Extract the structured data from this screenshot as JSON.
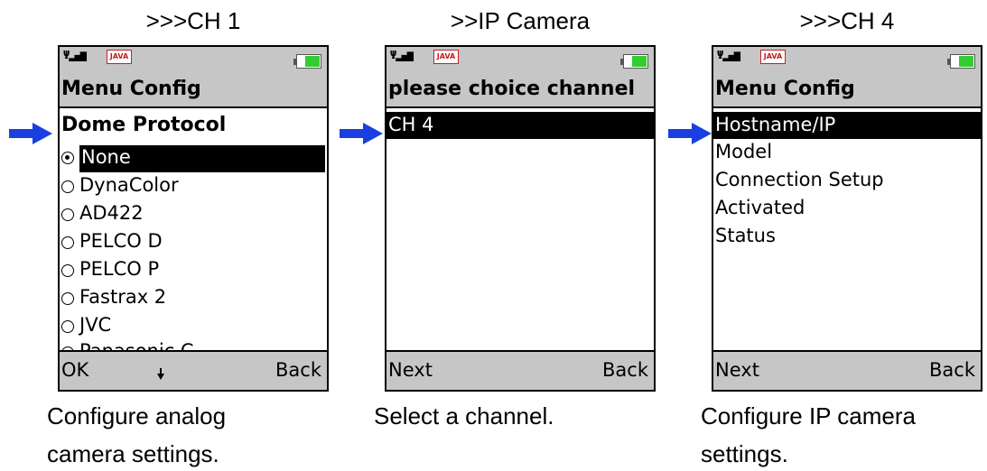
{
  "colors": {
    "arrow": "#1a3fe0",
    "chrome": "#c6c6c6",
    "highlight": "#000000",
    "battery": "#33cc33",
    "java_badge": "#c02020"
  },
  "status_bar": {
    "signal_icon": "signal-icon",
    "java_label": "JAVA",
    "battery_icon": "battery-icon"
  },
  "panels": [
    {
      "caption": ">>>CH 1",
      "title": "Menu Config",
      "list_header": "Dome Protocol",
      "options": [
        "None",
        "DynaColor",
        "AD422",
        "PELCO D",
        "PELCO P",
        "Fastrax 2",
        "JVC",
        "Panasonic C"
      ],
      "selected_option": "None",
      "left_softkey": "OK",
      "right_softkey": "Back",
      "description_line1": "Configure analog",
      "description_line2": "camera settings."
    },
    {
      "caption": ">>IP Camera",
      "title": "please choice channel",
      "items": [
        "CH 4"
      ],
      "selected_item": "CH 4",
      "left_softkey": "Next",
      "right_softkey": "Back",
      "description_line1": "Select a channel.",
      "description_line2": ""
    },
    {
      "caption": ">>>CH 4",
      "title": "Menu Config",
      "items": [
        "Hostname/IP",
        "Model",
        "Connection Setup",
        "Activated",
        "Status"
      ],
      "selected_item": "Hostname/IP",
      "left_softkey": "Next",
      "right_softkey": "Back",
      "description_line1": "Configure IP camera",
      "description_line2": "settings."
    }
  ]
}
